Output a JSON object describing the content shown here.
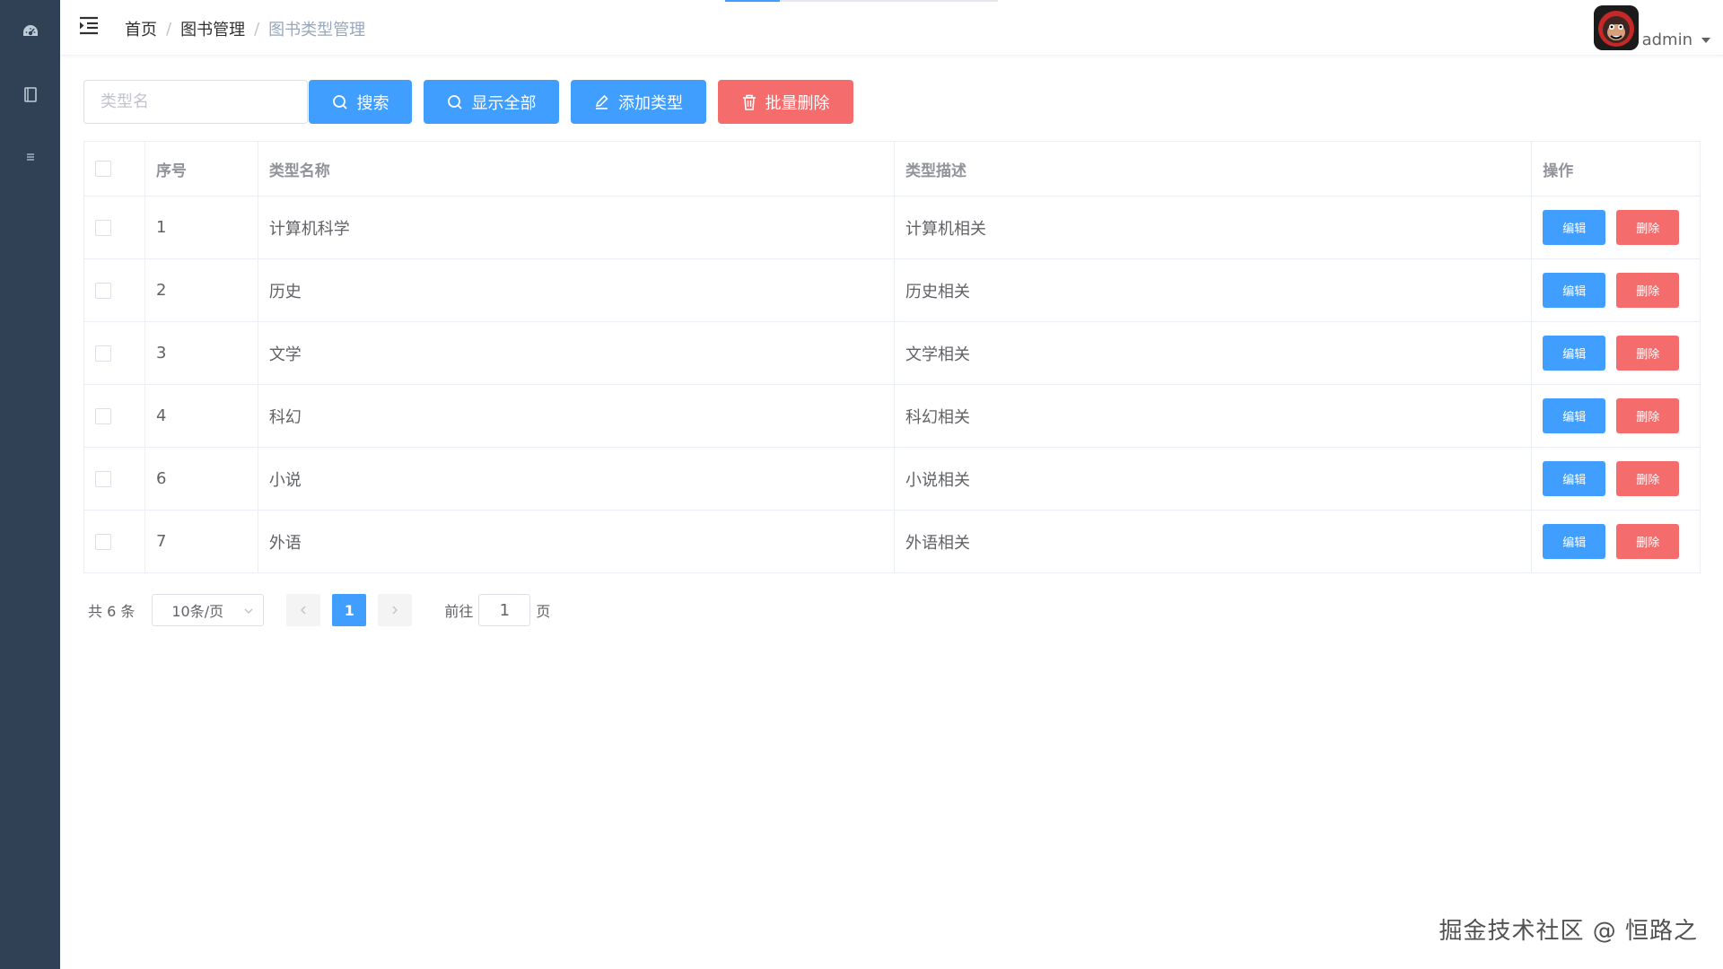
{
  "colors": {
    "sidebar_bg": "#304156",
    "primary": "#409eff",
    "danger": "#f56c6c",
    "border": "#ebeef5"
  },
  "sidebar": {
    "items": [
      {
        "icon": "dashboard-icon"
      },
      {
        "icon": "book-icon"
      },
      {
        "icon": "list-icon"
      }
    ]
  },
  "header": {
    "breadcrumb": [
      "首页",
      "图书管理",
      "图书类型管理"
    ],
    "separator": "/",
    "username": "admin",
    "progress": 0.2
  },
  "toolbar": {
    "search_placeholder": "类型名",
    "search_value": "",
    "search_label": "搜索",
    "show_all_label": "显示全部",
    "add_label": "添加类型",
    "batch_delete_label": "批量删除"
  },
  "table": {
    "headers": [
      "序号",
      "类型名称",
      "类型描述",
      "操作"
    ],
    "rows": [
      {
        "id": "1",
        "name": "计算机科学",
        "desc": "计算机相关"
      },
      {
        "id": "2",
        "name": "历史",
        "desc": "历史相关"
      },
      {
        "id": "3",
        "name": "文学",
        "desc": "文学相关"
      },
      {
        "id": "4",
        "name": "科幻",
        "desc": "科幻相关"
      },
      {
        "id": "6",
        "name": "小说",
        "desc": "小说相关"
      },
      {
        "id": "7",
        "name": "外语",
        "desc": "外语相关"
      }
    ],
    "edit_label": "编辑",
    "delete_label": "删除"
  },
  "pagination": {
    "total_text": "共 6 条",
    "page_size": "10条/页",
    "current_page": "1",
    "goto_label": "前往",
    "goto_value": "1",
    "goto_unit": "页"
  },
  "watermark": "掘金技术社区 @ 恒路之"
}
